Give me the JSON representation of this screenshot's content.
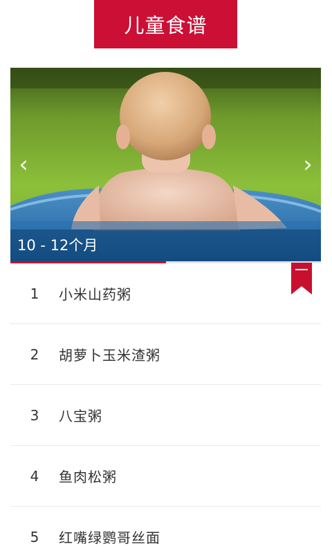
{
  "header": {
    "title": "儿童食谱"
  },
  "carousel": {
    "caption": "10 - 12个月",
    "prev_icon": "‹",
    "next_icon": "›",
    "progress_fraction": 0.5
  },
  "colors": {
    "accent": "#cc0f35",
    "caption_bar": "#0a3c6e"
  },
  "recipes": [
    {
      "num": "1",
      "name": "小米山药粥"
    },
    {
      "num": "2",
      "name": "胡萝卜玉米渣粥"
    },
    {
      "num": "3",
      "name": "八宝粥"
    },
    {
      "num": "4",
      "name": "鱼肉松粥"
    },
    {
      "num": "5",
      "name": "红嘴绿鹦哥丝面"
    }
  ]
}
